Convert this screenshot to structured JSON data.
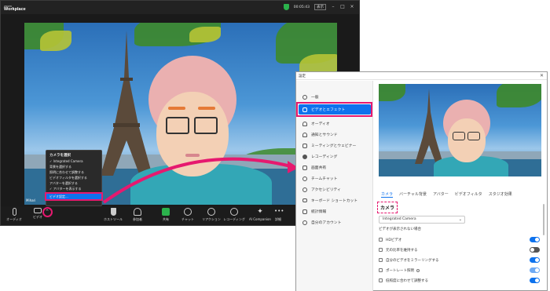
{
  "zoom": {
    "logo_line1": "zoom",
    "logo_line2": "Workplace",
    "timer": "00:05:43",
    "view_label": "表示",
    "camera_name_label": "Mihari"
  },
  "toolbar": [
    {
      "label": "オーディオ",
      "name": "audio-button",
      "icon": "mic-icon"
    },
    {
      "label": "ビデオ",
      "name": "video-button",
      "icon": "video-icon"
    },
    {
      "label": "ホストツール",
      "name": "host-tools-button",
      "icon": "shield-icon"
    },
    {
      "label": "参加者",
      "name": "participants-button",
      "icon": "people-icon"
    },
    {
      "label": "共有",
      "name": "share-button",
      "icon": "share-icon"
    },
    {
      "label": "チャット",
      "name": "chat-button",
      "icon": "chat-icon"
    },
    {
      "label": "リアクション",
      "name": "reactions-button",
      "icon": "smile-icon"
    },
    {
      "label": "レコーディング",
      "name": "record-button",
      "icon": "record-icon"
    },
    {
      "label": "AI Companion",
      "name": "ai-companion-button",
      "icon": "sparkle-icon"
    },
    {
      "label": "詳細",
      "name": "more-button",
      "icon": "more-icon"
    }
  ],
  "camera_menu": {
    "heading": "カメラを選択",
    "items": [
      "✓ Integrated Camera",
      "背景を選択する",
      "照明に合わせて調整する",
      "ビデオフィルタを選択する",
      "アバターを選択する",
      "✓ アバターを表示する"
    ],
    "video_settings": "ビデオ設定..."
  },
  "settings": {
    "title": "設定",
    "close": "✕",
    "sidebar": [
      {
        "label": "一般",
        "icon": "gear-icon",
        "name": "sidebar-item-general"
      },
      {
        "label": "ビデオとエフェクト",
        "icon": "video-icon",
        "name": "sidebar-item-video-effects"
      },
      {
        "label": "オーディオ",
        "icon": "headphones-icon",
        "name": "sidebar-item-audio"
      },
      {
        "label": "通知とサウンド",
        "icon": "bell-icon",
        "name": "sidebar-item-notifications"
      },
      {
        "label": "ミーティングとウェビナー",
        "icon": "meeting-icon",
        "name": "sidebar-item-meetings"
      },
      {
        "label": "レコーディング",
        "icon": "record-icon",
        "name": "sidebar-item-recording"
      },
      {
        "label": "画面共有",
        "icon": "share-screen-icon",
        "name": "sidebar-item-screen-share"
      },
      {
        "label": "チームチャット",
        "icon": "chat-icon",
        "name": "sidebar-item-team-chat"
      },
      {
        "label": "アクセシビリティ",
        "icon": "accessibility-icon",
        "name": "sidebar-item-accessibility"
      },
      {
        "label": "キーボード ショートカット",
        "icon": "keyboard-icon",
        "name": "sidebar-item-shortcuts"
      },
      {
        "label": "統計情報",
        "icon": "stats-icon",
        "name": "sidebar-item-statistics"
      },
      {
        "label": "自分のアカウント",
        "icon": "account-icon",
        "name": "sidebar-item-account"
      }
    ],
    "tabs": [
      "カメラ",
      "バーチャル背景",
      "アバター",
      "ビデオフィルタ",
      "スタジオ効果"
    ],
    "camera_heading": "カメラ",
    "camera_select": "Integrated Camera",
    "no_video_text": "ビデオが表示されない場合",
    "options": [
      {
        "label": "HDビデオ",
        "on": true,
        "info": false
      },
      {
        "label": "元の比率を維持する",
        "on": false,
        "info": false
      },
      {
        "label": "自分のビデオをミラーリングする",
        "on": true,
        "info": false
      },
      {
        "label": "ポートレート照明",
        "on": true,
        "info": true
      },
      {
        "label": "低照度に合わせて調整する",
        "on": true,
        "info": false
      }
    ]
  },
  "colors": {
    "accent": "#0e72ed",
    "highlight": "#e6196f"
  }
}
